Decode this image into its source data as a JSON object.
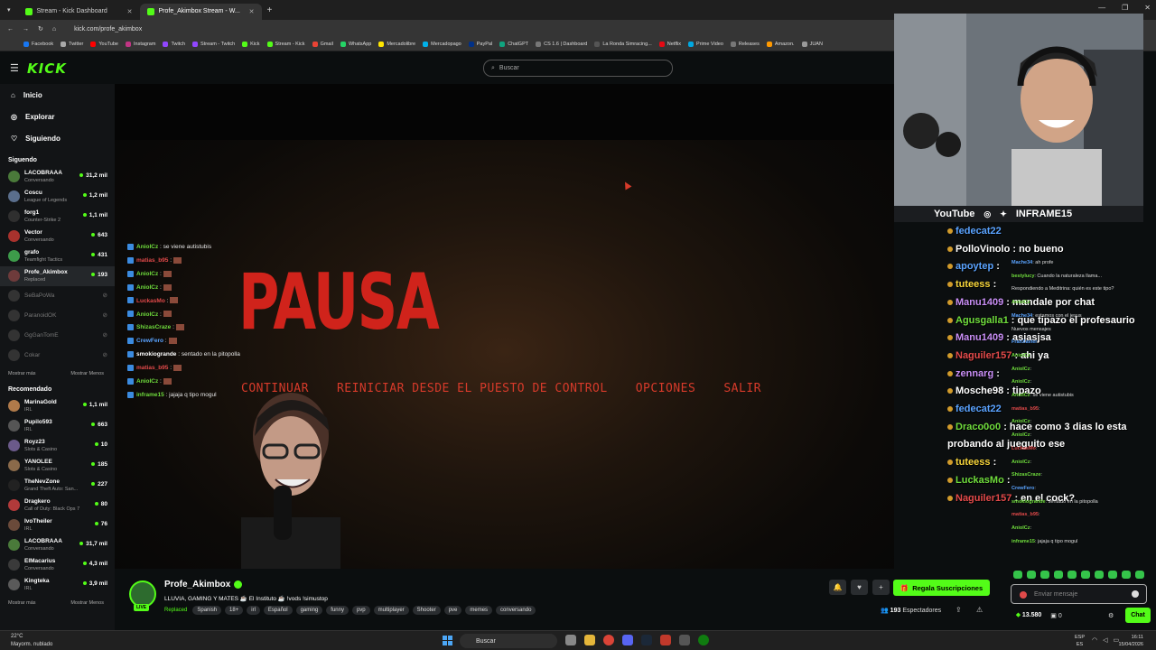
{
  "browser": {
    "tabs": [
      {
        "title": "Stream - Kick Dashboard"
      },
      {
        "title": "Profe_Akimbox Stream - W..."
      }
    ],
    "url": "kick.com/profe_akimbox",
    "bookmarks": [
      "Facebook",
      "Twitter",
      "YouTube",
      "Instagram",
      "Twitch",
      "Stream - Twitch",
      "Kick",
      "Stream - Kick",
      "Gmail",
      "WhatsApp",
      "Mercadolibre",
      "Mercadopago",
      "PayPal",
      "ChatGPT",
      "CS 1.6 | Dashboard",
      "La Ronda Simracing...",
      "Netflix",
      "Prime Video",
      "Releases",
      "Amazon.",
      "JUAN"
    ]
  },
  "header": {
    "logo": "KICK",
    "search_placeholder": "Buscar"
  },
  "sidebar": {
    "nav": [
      {
        "label": "Inicio",
        "icon": "home-icon"
      },
      {
        "label": "Explorar",
        "icon": "compass-icon"
      },
      {
        "label": "Siguiendo",
        "icon": "heart-icon"
      }
    ],
    "following_title": "Siguendo",
    "following": [
      {
        "name": "LACOBRAAA",
        "game": "Conversando",
        "viewers": "31,2 mil",
        "color": "#4a7a3a"
      },
      {
        "name": "Coscu",
        "game": "League of Legends",
        "viewers": "1,2 mil",
        "color": "#5a6e8c"
      },
      {
        "name": "forg1",
        "game": "Counter-Strike 2",
        "viewers": "1,1 mil",
        "color": "#2f2f2f"
      },
      {
        "name": "Vector",
        "game": "Conversando",
        "viewers": "643",
        "color": "#a8322d"
      },
      {
        "name": "grafo",
        "game": "Teamfight Tactics",
        "viewers": "431",
        "color": "#3d9b4a"
      },
      {
        "name": "Profe_Akimbox",
        "game": "Replaced",
        "viewers": "193",
        "color": "#6e3b3b"
      }
    ],
    "offline": [
      "SeBaPoWa",
      "ParanoidOK",
      "GgGanTomE",
      "Cokar"
    ],
    "show_more": "Mostrar más",
    "show_less": "Mostrar Menos",
    "recommended_title": "Recomendado",
    "recommended": [
      {
        "name": "MarinaGold",
        "game": "IRL",
        "viewers": "1,1 mil",
        "color": "#b07a4a"
      },
      {
        "name": "Pupilo593",
        "game": "IRL",
        "viewers": "663",
        "color": "#555"
      },
      {
        "name": "Royz23",
        "game": "Slots & Casino",
        "viewers": "10",
        "color": "#6b5a8a"
      },
      {
        "name": "YANOLEE",
        "game": "Slots & Casino",
        "viewers": "185",
        "color": "#8a6a4a"
      },
      {
        "name": "TheNevZone",
        "game": "Grand Theft Auto: San...",
        "viewers": "227",
        "color": "#222"
      },
      {
        "name": "Dragkero",
        "game": "Call of Duty: Black Ops 7",
        "viewers": "80",
        "color": "#b23a3a"
      },
      {
        "name": "IvoTheiler",
        "game": "IRL",
        "viewers": "76",
        "color": "#6a4a3a"
      },
      {
        "name": "LACOBRAAA",
        "game": "Conversando",
        "viewers": "31,7 mil",
        "color": "#4a7a3a"
      },
      {
        "name": "ElMacarius",
        "game": "Conversando",
        "viewers": "4,3 mil",
        "color": "#3a3a3a"
      },
      {
        "name": "Kingteka",
        "game": "IRL",
        "viewers": "3,9 mil",
        "color": "#5a5a5a"
      }
    ]
  },
  "game": {
    "pause_title": "PAUSA",
    "menu": [
      "CONTINUAR",
      "REINICIAR DESDE EL PUESTO DE CONTROL",
      "OPCIONES",
      "SALIR"
    ]
  },
  "overlay_chat": [
    {
      "user": "AnioICz",
      "text": ": se viene autistubis",
      "color": "g"
    },
    {
      "user": "matias_b95",
      "text": ":",
      "color": "r"
    },
    {
      "user": "AnioICz",
      "text": ":",
      "color": "g"
    },
    {
      "user": "AnioICz",
      "text": ":",
      "color": "g"
    },
    {
      "user": "LuckasMo",
      "text": ":",
      "color": "r"
    },
    {
      "user": "AnioICz",
      "text": ":",
      "color": "g"
    },
    {
      "user": "ShizasCraze",
      "text": ":",
      "color": "g"
    },
    {
      "user": "CrewFero",
      "text": ":",
      "color": "b"
    },
    {
      "user": "smokiogrande",
      "text": ": sentado en la pitopolla",
      "color": "w"
    },
    {
      "user": "matias_b95",
      "text": ":",
      "color": "r"
    },
    {
      "user": "AnioICz",
      "text": ":",
      "color": "g"
    },
    {
      "user": "inframe15",
      "text": ": jajaja q tipo mogul",
      "color": "g"
    }
  ],
  "stream": {
    "name": "Profe_Akimbox",
    "live_badge": "LIVE",
    "title": "LLUVIA, GAMING Y MATES ☕ El Instituto ☕ !vods !simustop",
    "category": "Replaced",
    "tags": [
      "Spanish",
      "18+",
      "irl",
      "Español",
      "gaming",
      "funny",
      "pvp",
      "multiplayer",
      "Shooter",
      "pve",
      "memes",
      "conversando"
    ],
    "gift_label": "Regala Suscripciones",
    "viewers": "193",
    "viewers_label": "Espectadores"
  },
  "cam_footer": {
    "left": "YouTube",
    "right": "INFRAME15"
  },
  "big_chat": [
    {
      "user": "fedecat22",
      "text": "",
      "color": "#5aa3ff"
    },
    {
      "user": "PolloVinolo",
      "text": ": no bueno",
      "color": "#ffffff"
    },
    {
      "user": "apoytep",
      "text": ":",
      "color": "#5aa3ff"
    },
    {
      "user": "tuteess",
      "text": ":",
      "color": "#f5d33a"
    },
    {
      "user": "Manu1409",
      "text": ": mandale por chat",
      "color": "#c88ef5"
    },
    {
      "user": "Agusgalla1",
      "text": ": que tipazo el profesaurio",
      "color": "#6fdc3c"
    },
    {
      "user": "Manu1409",
      "text": ": asjasjsa",
      "color": "#c88ef5"
    },
    {
      "user": "Naguiler157",
      "text": ": ahi ya",
      "color": "#e34a4a"
    },
    {
      "user": "zennarg",
      "text": ":",
      "color": "#c88ef5"
    },
    {
      "user": "Mosche98",
      "text": ": tipazo",
      "color": "#ffffff"
    },
    {
      "user": "fedecat22",
      "text": "",
      "color": "#5aa3ff"
    },
    {
      "user": "Draco0o0",
      "text": ": hace como 3 dias lo esta",
      "color": "#6fdc3c"
    },
    {
      "user": "",
      "text": "probando al jueguito ese",
      "color": "#ffffff"
    },
    {
      "user": "tuteess",
      "text": ":",
      "color": "#f5d33a"
    },
    {
      "user": "LuckasMo",
      "text": ":",
      "color": "#6fdc3c"
    },
    {
      "user": "Naguiler157",
      "text": ": en el cock?",
      "color": "#e34a4a"
    }
  ],
  "small_chat": [
    {
      "user": "Mache34",
      "text": ": ah profe",
      "color": "b"
    },
    {
      "user": "bestylucy",
      "text": ": Cuando la naturaleza llama...",
      "color": "w"
    },
    {
      "user": "",
      "text": "Respondiendo a Meditrina: quién es este tipo?",
      "color": "w"
    },
    {
      "user": "AnioICz",
      "text": ":",
      "color": "g"
    },
    {
      "user": "Mache34",
      "text": ": estamos con el jesus",
      "color": "b"
    },
    {
      "user": "",
      "text": "Nuevos mensajes",
      "color": "g"
    },
    {
      "user": "FranXavier",
      "text": ":",
      "color": "b"
    },
    {
      "user": "AnioICz",
      "text": ":",
      "color": "g"
    },
    {
      "user": "AnioICz",
      "text": ":",
      "color": "g"
    },
    {
      "user": "AnioICz",
      "text": ":",
      "color": "g"
    },
    {
      "user": "AnioICz",
      "text": ": se viene autistubis",
      "color": "g"
    },
    {
      "user": "matias_b95",
      "text": ":",
      "color": "r"
    },
    {
      "user": "AnioICz",
      "text": ":",
      "color": "g"
    },
    {
      "user": "AnioICz",
      "text": ":",
      "color": "g"
    },
    {
      "user": "LuckasMo",
      "text": ":",
      "color": "r"
    },
    {
      "user": "AnioICz",
      "text": ":",
      "color": "g"
    },
    {
      "user": "ShizasCraze",
      "text": ":",
      "color": "g"
    },
    {
      "user": "CrewFero",
      "text": ":",
      "color": "b"
    },
    {
      "user": "smokiogrande",
      "text": ": sentado en la pitopolla",
      "color": "w"
    },
    {
      "user": "matias_b95",
      "text": ":",
      "color": "r"
    },
    {
      "user": "AnioICz",
      "text": ":",
      "color": "g"
    },
    {
      "user": "inframe15",
      "text": ": jajaja q tipo mogul",
      "color": "g"
    }
  ],
  "chat_input": {
    "placeholder": "Enviar mensaje"
  },
  "chat_footer": {
    "points": "13.580",
    "count": "0",
    "chat_button": "Chat"
  },
  "taskbar": {
    "temp": "22°C",
    "weather": "Mayorm. nublado",
    "search": "Buscar",
    "lang1": "ESP",
    "lang2": "ES",
    "time": "16:11",
    "date": "15/04/2026"
  }
}
